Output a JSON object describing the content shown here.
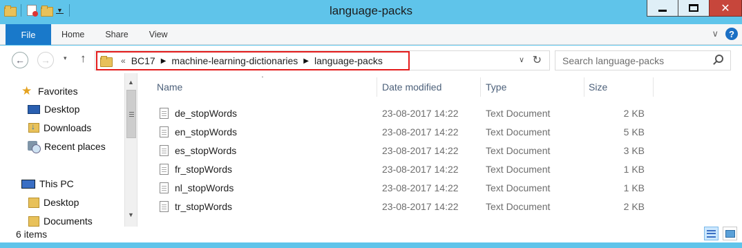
{
  "window": {
    "title": "language-packs",
    "close_glyph": "✕"
  },
  "ribbon": {
    "file_tab": "File",
    "tabs": [
      "Home",
      "Share",
      "View"
    ],
    "help_glyph": "?",
    "expand_glyph": "∨"
  },
  "navigation": {
    "back_glyph": "←",
    "forward_glyph": "→",
    "recent_glyph": "▾",
    "up_glyph": "↑"
  },
  "address": {
    "overflow": "«",
    "crumbs": [
      "BC17",
      "machine-learning-dictionaries",
      "language-packs"
    ],
    "arrow_glyph": "▶",
    "dropdown_glyph": "∨",
    "refresh_glyph": "↻"
  },
  "search": {
    "placeholder": "Search language-packs"
  },
  "nav_pane": {
    "favorites": "Favorites",
    "favorites_items": [
      "Desktop",
      "Downloads",
      "Recent places"
    ],
    "this_pc": "This PC",
    "this_pc_items": [
      "Desktop",
      "Documents"
    ]
  },
  "scrollbar": {
    "up_glyph": "▲",
    "down_glyph": "▼"
  },
  "file_list": {
    "sort_glyph": "▲",
    "columns": [
      "Name",
      "Date modified",
      "Type",
      "Size"
    ],
    "rows": [
      {
        "name": "de_stopWords",
        "date": "23-08-2017 14:22",
        "type": "Text Document",
        "size": "2 KB"
      },
      {
        "name": "en_stopWords",
        "date": "23-08-2017 14:22",
        "type": "Text Document",
        "size": "5 KB"
      },
      {
        "name": "es_stopWords",
        "date": "23-08-2017 14:22",
        "type": "Text Document",
        "size": "3 KB"
      },
      {
        "name": "fr_stopWords",
        "date": "23-08-2017 14:22",
        "type": "Text Document",
        "size": "1 KB"
      },
      {
        "name": "nl_stopWords",
        "date": "23-08-2017 14:22",
        "type": "Text Document",
        "size": "1 KB"
      },
      {
        "name": "tr_stopWords",
        "date": "23-08-2017 14:22",
        "type": "Text Document",
        "size": "2 KB"
      }
    ]
  },
  "status": {
    "item_count": "6 items"
  },
  "colors": {
    "title_bar": "#5fc4ea",
    "file_tab": "#1979ca",
    "highlight_box": "#e41b1b",
    "close_button": "#c7463b"
  }
}
